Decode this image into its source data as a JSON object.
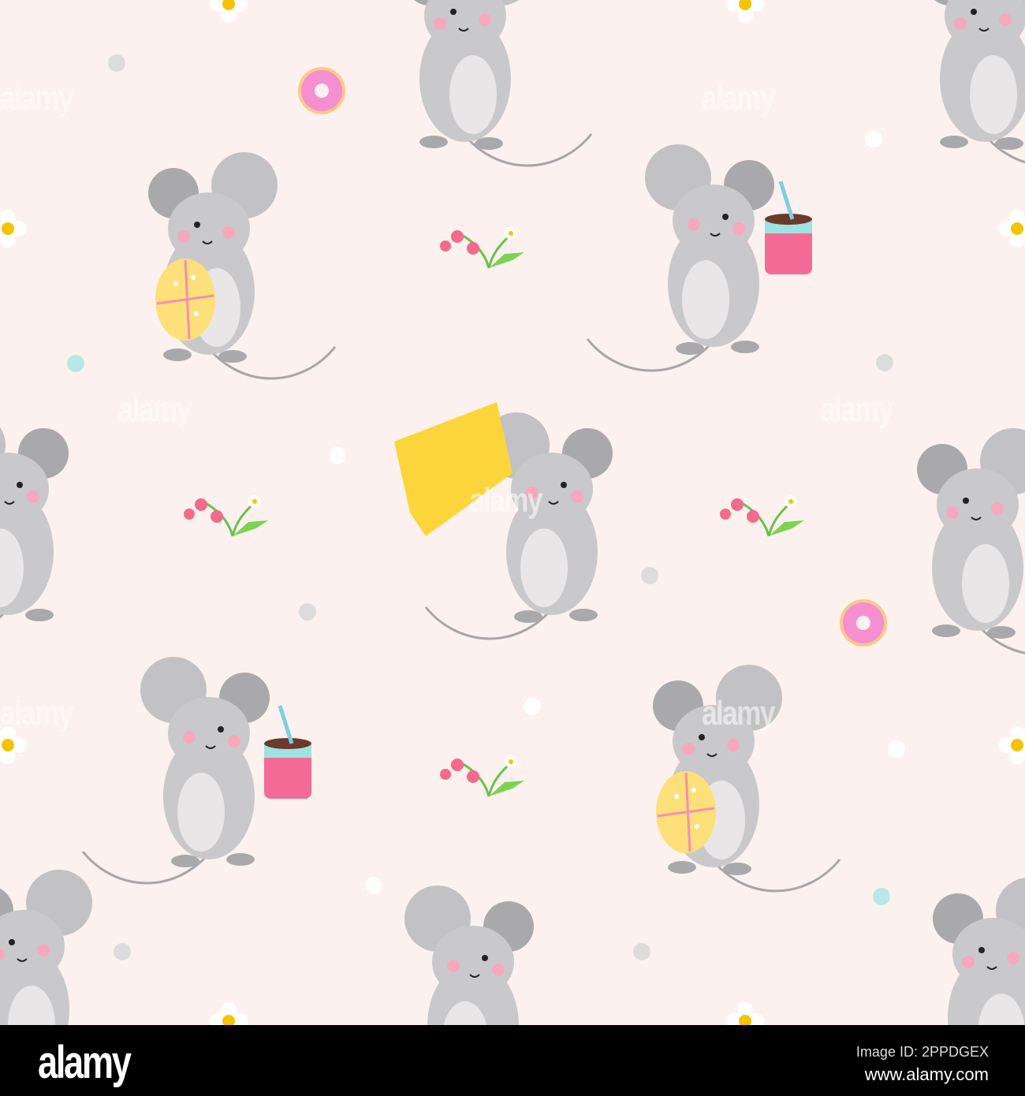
{
  "watermark": {
    "text": "alamy"
  },
  "footer": {
    "logo": "alamy",
    "image_id": "Image ID: 2PPDGEX",
    "website": "www.alamy.com"
  },
  "colors": {
    "background": "#fcf1ee",
    "mouse_body": "#c9c9cb",
    "mouse_ear": "#a9a9ab",
    "cheek": "#f7a8be",
    "cheese": "#fcd53a",
    "cup": "#f36b96",
    "ribbon": "#9ee3e0"
  }
}
